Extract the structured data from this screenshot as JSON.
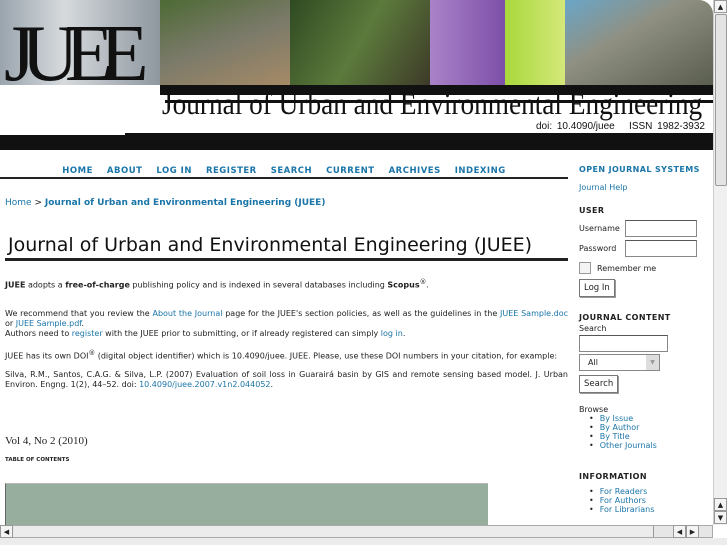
{
  "header": {
    "logo": "JUEE",
    "title": "Journal of Urban and Environmental Engineering",
    "doi": "doi: 10.4090/juee",
    "issn": "ISSN 1982-3932"
  },
  "nav": [
    "HOME",
    "ABOUT",
    "LOG IN",
    "REGISTER",
    "SEARCH",
    "CURRENT",
    "ARCHIVES",
    "INDEXING"
  ],
  "breadcrumb": {
    "home": "Home",
    "sep": ">",
    "current": "Journal of Urban and Environmental Engineering (JUEE)"
  },
  "page_title": "Journal of Urban and Environmental Engineering (JUEE)",
  "intro": {
    "a": "JUEE",
    "b": " adopts a ",
    "c": "free-of-charge",
    "d": " publishing policy and is indexed in several databases including ",
    "e": "Scopus",
    "f": "®",
    "g": "."
  },
  "recommend": {
    "a": "We recommend that you review the ",
    "link1": "About the Journal",
    "b": " page for the JUEE's section policies, as well as the guidelines in the ",
    "link2": "JUEE Sample.doc",
    "c": " or ",
    "link3": "JUEE Sample.pdf",
    "d": ".",
    "e": "Authors need to ",
    "link4": "register",
    "f": " with the JUEE prior to submitting, or if already registered can simply ",
    "link5": "log in",
    "g": "."
  },
  "doi_text": {
    "a": "JUEE has its own DOI",
    "sup": "®",
    "b": " (digital object identifier) which is 10.4090/juee. JUEE. Please, use these DOI numbers in your citation, for example:"
  },
  "citation": {
    "text": "Silva, R.M., Santos, C.A.G. & Silva, L.P. (2007) Evaluation of soil loss in Guarairá basin by GIS and remote sensing based model. J. Urban Environ. Engng. 1(2), 44–52. doi: ",
    "link": "10.4090/juee.2007.v1n2.044052",
    "end": "."
  },
  "issue": "Vol 4, No 2 (2010)",
  "toc": "TABLE OF CONTENTS",
  "sidebar": {
    "ojs": "OPEN JOURNAL SYSTEMS",
    "help": "Journal Help",
    "user": "USER",
    "username": "Username",
    "password": "Password",
    "remember": "Remember me",
    "login": "Log In",
    "content": "JOURNAL CONTENT",
    "search": "Search",
    "scope": "All",
    "search_btn": "Search",
    "browse": "Browse",
    "browse_items": [
      "By Issue",
      "By Author",
      "By Title",
      "Other Journals"
    ],
    "information": "INFORMATION",
    "info_items": [
      "For Readers",
      "For Authors",
      "For Librarians"
    ]
  }
}
